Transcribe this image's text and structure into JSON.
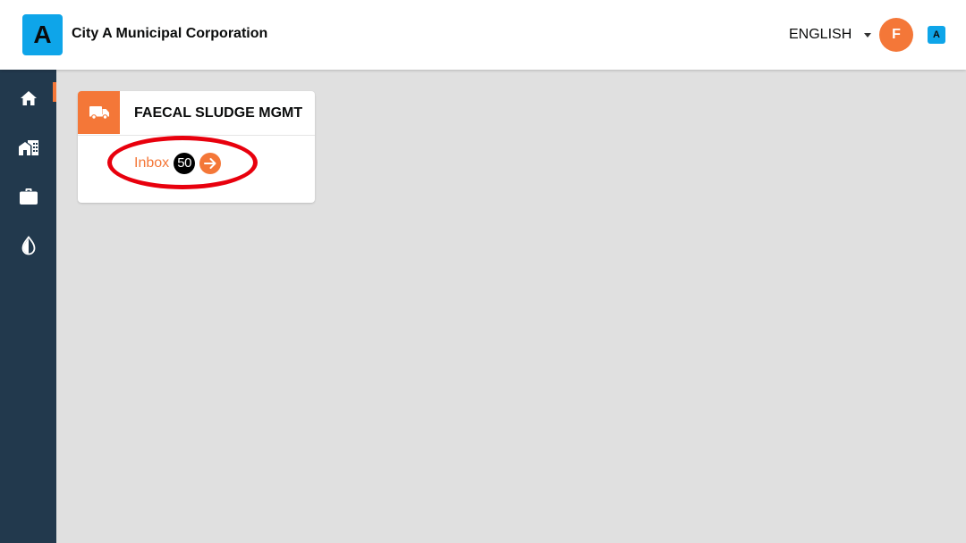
{
  "header": {
    "logo_letter": "A",
    "city_name": "City A Municipal Corporation",
    "language": "ENGLISH",
    "avatar_initial": "F",
    "mini_logo_letter": "A"
  },
  "sidebar": {
    "items": [
      {
        "icon": "home-icon"
      },
      {
        "icon": "city-icon"
      },
      {
        "icon": "briefcase-icon"
      },
      {
        "icon": "water-drop-icon"
      }
    ]
  },
  "card": {
    "title": "FAECAL SLUDGE MGMT",
    "icon": "truck-icon",
    "inbox_label": "Inbox",
    "inbox_count": "50"
  },
  "colors": {
    "accent": "#f47738",
    "sidebar": "#22394d",
    "logo": "#0ea5e9",
    "highlight": "#e8000d"
  }
}
